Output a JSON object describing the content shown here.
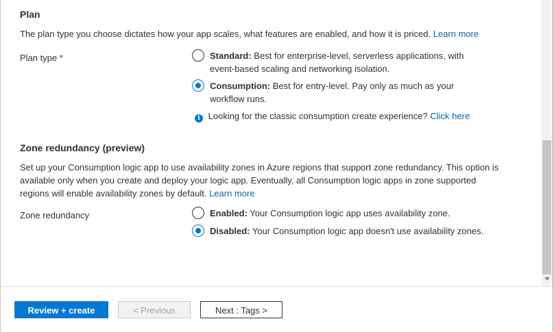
{
  "plan": {
    "heading": "Plan",
    "description": "The plan type you choose dictates how your app scales, what features are enabled, and how it is priced.",
    "learn_more": "Learn more",
    "plan_type_label": "Plan type",
    "required_marker": "*",
    "options": [
      {
        "title": "Standard:",
        "text": "Best for enterprise-level, serverless applications, with event-based scaling and networking isolation.",
        "selected": false
      },
      {
        "title": "Consumption:",
        "text": "Best for entry-level. Pay only as much as your workflow runs.",
        "selected": true
      }
    ],
    "classic_info": "Looking for the classic consumption create experience?",
    "classic_link": "Click here"
  },
  "zone": {
    "heading": "Zone redundancy (preview)",
    "description": "Set up your Consumption logic app to use availability zones in Azure regions that support zone redundancy. This option is available only when you create and deploy your logic app. Eventually, all Consumption logic apps in zone supported regions will enable availability zones by default.",
    "learn_more": "Learn more",
    "label": "Zone redundancy",
    "options": [
      {
        "title": "Enabled:",
        "text": "Your Consumption logic app uses availability zone.",
        "selected": false
      },
      {
        "title": "Disabled:",
        "text": "Your Consumption logic app doesn't use availability zones.",
        "selected": true
      }
    ]
  },
  "footer": {
    "review_create": "Review + create",
    "previous": "< Previous",
    "next": "Next : Tags >"
  },
  "colors": {
    "accent": "#0078d4",
    "link": "#0063b1",
    "required": "#a4262c"
  },
  "icons": {
    "info": "info-icon",
    "scroll_down": "chevron-down-icon"
  }
}
